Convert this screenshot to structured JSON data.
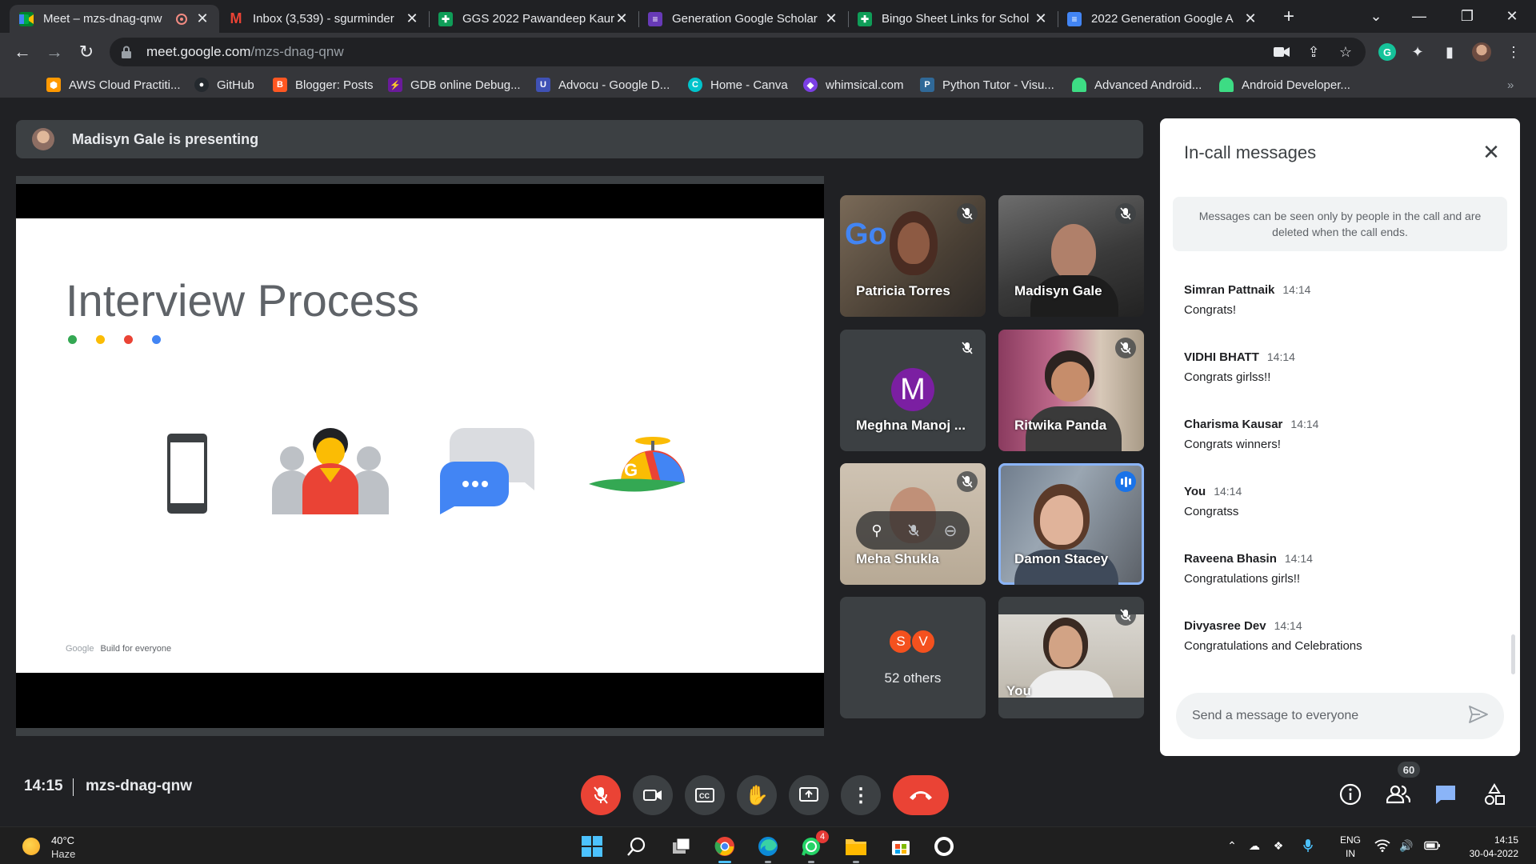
{
  "browser": {
    "tabs": [
      {
        "title": "Meet – mzs-dnag-qnw",
        "favicon_color": "#00832d",
        "active": true
      },
      {
        "title": "Inbox (3,539) - sgurminder",
        "favicon_color": "#ea4335"
      },
      {
        "title": "GGS 2022 Pawandeep Kaur",
        "favicon_color": "#0f9d58"
      },
      {
        "title": "Generation Google Scholar",
        "favicon_color": "#673ab7"
      },
      {
        "title": "Bingo Sheet Links for Schol",
        "favicon_color": "#0f9d58"
      },
      {
        "title": "2022 Generation Google A",
        "favicon_color": "#4285f4"
      }
    ],
    "new_tab_label": "+",
    "address": {
      "host": "meet.google.com",
      "path": "/mzs-dnag-qnw"
    },
    "bookmarks": [
      {
        "label": "AWS Cloud Practiti...",
        "color": "#ff9900"
      },
      {
        "label": "GitHub",
        "color": "#24292e"
      },
      {
        "label": "Blogger: Posts",
        "color": "#ff5722"
      },
      {
        "label": "GDB online Debug...",
        "color": "#6a1b9a"
      },
      {
        "label": "Advocu - Google D...",
        "color": "#3f51b5"
      },
      {
        "label": "Home - Canva",
        "color": "#00c4cc"
      },
      {
        "label": "whimsical.com",
        "color": "#7b3fe4"
      },
      {
        "label": "Python Tutor - Visu...",
        "color": "#306998"
      },
      {
        "label": "Advanced Android...",
        "color": "#3ddc84"
      },
      {
        "label": "Android Developer...",
        "color": "#3ddc84"
      }
    ],
    "bookmarks_overflow": "»"
  },
  "meet": {
    "presenting_banner": "Madisyn Gale is presenting",
    "slide": {
      "title": "Interview Process",
      "dots": [
        "#34a853",
        "#fbbc04",
        "#ea4335",
        "#4285f4"
      ],
      "footer_brand": "Google",
      "footer_text": "Build for everyone"
    },
    "participants": [
      {
        "name": "Patricia Torres",
        "muted": true
      },
      {
        "name": "Madisyn Gale",
        "muted": true
      },
      {
        "name": "Meghna Manoj ...",
        "initial": "M",
        "avatar_color": "#7b1fa2",
        "muted": true
      },
      {
        "name": "Ritwika Panda",
        "muted": true
      },
      {
        "name": "Meha Shukla",
        "muted": true
      },
      {
        "name": "Damon Stacey",
        "speaking": true
      },
      {
        "name": "52 others",
        "initials": [
          "S",
          "V"
        ]
      },
      {
        "name": "You",
        "muted": true
      }
    ],
    "chat": {
      "title": "In-call messages",
      "notice": "Messages can be seen only by people in the call and are deleted when the call ends.",
      "messages": [
        {
          "sender": "Simran Pattnaik",
          "time": "14:14",
          "text": "Congrats!"
        },
        {
          "sender": "VIDHI BHATT",
          "time": "14:14",
          "text": "Congrats girlss!!"
        },
        {
          "sender": "Charisma Kausar",
          "time": "14:14",
          "text": "Congrats winners!"
        },
        {
          "sender": "You",
          "time": "14:14",
          "text": "Congratss"
        },
        {
          "sender": "Raveena Bhasin",
          "time": "14:14",
          "text": "Congratulations girls!!"
        },
        {
          "sender": "Divyasree Dev",
          "time": "14:14",
          "text": "Congratulations and Celebrations"
        }
      ],
      "input_placeholder": "Send a message to everyone"
    },
    "bottom": {
      "time": "14:15",
      "meeting_code": "mzs-dnag-qnw",
      "people_count": "60"
    }
  },
  "taskbar": {
    "weather_temp": "40°C",
    "weather_desc": "Haze",
    "whatsapp_badge": "4",
    "lang_line1": "ENG",
    "lang_line2": "IN",
    "time": "14:15",
    "date": "30-04-2022"
  }
}
